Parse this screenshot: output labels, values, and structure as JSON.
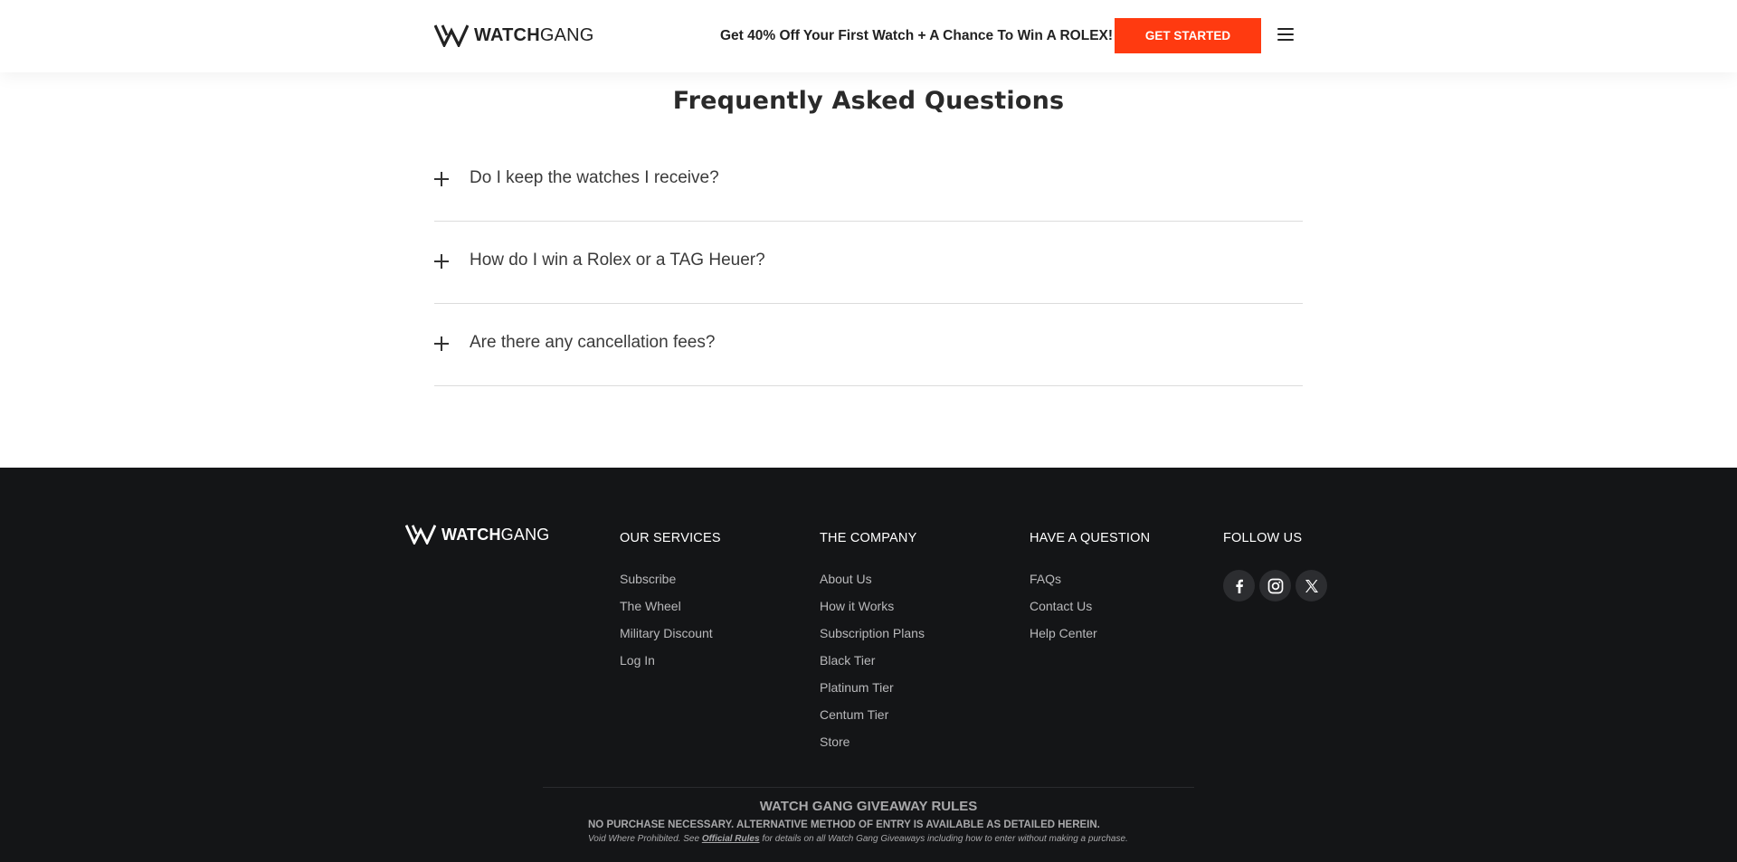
{
  "header": {
    "logo_bold": "WATCH",
    "logo_light": "GANG",
    "promo": "Get 40% Off Your First Watch + A Chance To Win A ROLEX!",
    "cta_label": "GET STARTED",
    "menu_icon": "hamburger-menu-icon"
  },
  "faq": {
    "title": "Frequently Asked Questions",
    "items": [
      {
        "question": "Do I keep the watches I receive?"
      },
      {
        "question": "How do I win a Rolex or a TAG Heuer?"
      },
      {
        "question": "Are there any cancellation fees?"
      }
    ]
  },
  "footer": {
    "logo_bold": "WATCH",
    "logo_light": "GANG",
    "services": {
      "heading": "OUR SERVICES",
      "links": [
        "Subscribe",
        "The Wheel",
        "Military Discount",
        "Log In"
      ]
    },
    "company": {
      "heading": "THE COMPANY",
      "links": [
        "About Us",
        "How it Works",
        "Subscription Plans",
        "Black Tier",
        "Platinum Tier",
        "Centum Tier",
        "Store"
      ]
    },
    "question": {
      "heading": "HAVE A QUESTION",
      "links": [
        "FAQs",
        "Contact Us",
        "Help Center"
      ]
    },
    "follow": {
      "heading": "FOLLOW US",
      "icons": [
        "facebook-icon",
        "instagram-icon",
        "x-twitter-icon"
      ]
    },
    "rules": {
      "title": "WATCH GANG GIVEAWAY RULES",
      "bold_line": "NO PURCHASE NECESSARY. ALTERNATIVE METHOD OF ENTRY IS AVAILABLE AS DETAILED HEREIN.",
      "small_prefix": "Void Where Prohibited. See ",
      "small_link": "Official Rules",
      "small_suffix": " for details on all Watch Gang Giveaways including how to enter without making a purchase."
    }
  },
  "colors": {
    "accent": "#ff3a10",
    "footer_bg": "#141517"
  }
}
